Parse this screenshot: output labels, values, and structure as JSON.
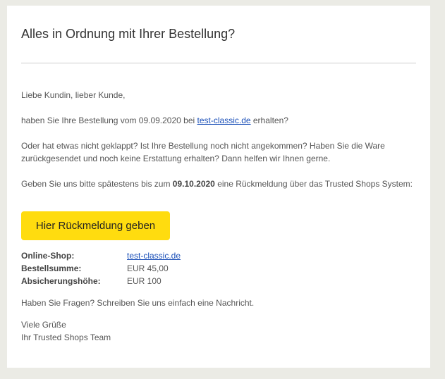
{
  "email": {
    "title": "Alles in Ordnung mit Ihrer Bestellung?",
    "greeting": "Liebe Kundin, lieber Kunde,",
    "order_question": {
      "prefix": "haben Sie Ihre Bestellung vom 09.09.2020 bei ",
      "shop_link": "test-classic.de",
      "suffix": " erhalten?"
    },
    "problem_text": "Oder hat etwas nicht geklappt? Ist Ihre Bestellung noch nicht angekommen? Haben Sie die Ware zurückgesendet und noch keine Erstattung erhalten? Dann helfen wir Ihnen gerne.",
    "deadline_text": {
      "prefix": "Geben Sie uns bitte spätestens bis zum ",
      "date": "09.10.2020",
      "suffix": " eine Rückmeldung über das Trusted Shops System:"
    },
    "feedback_button": "Hier Rückmeldung geben",
    "details": [
      {
        "label": "Online-Shop:",
        "value": "test-classic.de",
        "link": true
      },
      {
        "label": "Bestellsumme:",
        "value": "EUR 45,00",
        "link": false
      },
      {
        "label": "Absicherungshöhe:",
        "value": "EUR 100",
        "link": false
      }
    ],
    "questions_text": "Haben Sie Fragen? Schreiben Sie uns einfach eine Nachricht.",
    "closing": "Viele Grüße",
    "signature": "Ihr Trusted Shops Team"
  },
  "colors": {
    "background": "#ebebe5",
    "card": "#ffffff",
    "button": "#ffdc0f",
    "link": "#1a4fb8"
  }
}
